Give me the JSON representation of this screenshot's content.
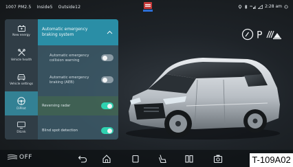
{
  "status": {
    "pm": "1007 PM2.5",
    "inside": "Inside5",
    "outside": "Outside12",
    "time": "2:28 am"
  },
  "gear": {
    "mode": "P"
  },
  "nav": [
    {
      "label": "New energy",
      "icon": "battery-icon",
      "active": false
    },
    {
      "label": "Vehicle health",
      "icon": "tools-icon",
      "active": false
    },
    {
      "label": "Vehicle settings",
      "icon": "car-front-icon",
      "active": false
    },
    {
      "label": "DiPilot",
      "icon": "steering-wheel-icon",
      "active": true
    },
    {
      "label": "DiLink",
      "icon": "screen-icon",
      "active": false
    }
  ],
  "settings": {
    "header": "Automatic emergency braking system",
    "items": [
      {
        "label": "Automatic emergency collision warning",
        "on": false
      },
      {
        "label": "Automatic emergency braking (AEB)",
        "on": false
      },
      {
        "label": "Reversing radar",
        "on": true
      },
      {
        "label": "Blind spot detection",
        "on": true
      }
    ]
  },
  "bottombar": {
    "ac": "OFF",
    "icons": [
      "back-icon",
      "home-icon",
      "square-icon",
      "seat-icon",
      "grid-icon",
      "camera-icon"
    ]
  },
  "badge": "T-109A02",
  "colors": {
    "accent": "#2a8ea6",
    "toggle_on": "#2fd1b0"
  }
}
